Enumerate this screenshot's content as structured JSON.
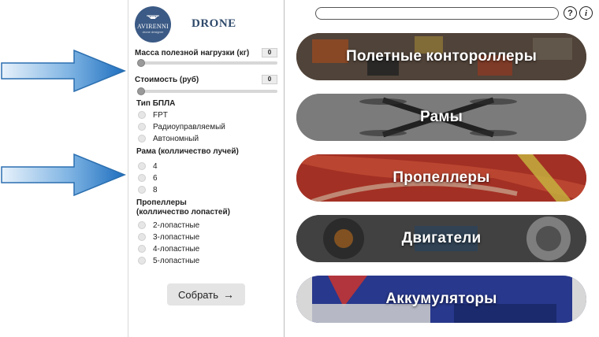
{
  "brand": {
    "logo_text": "AVIRENNI",
    "logo_subtext": "drone designer",
    "title": "DRONE"
  },
  "filters": {
    "payload": {
      "label": "Масса полезной нагрузки (кг)",
      "value": "0"
    },
    "cost": {
      "label": "Стоимость (руб)",
      "value": "0"
    },
    "uav_type": {
      "title": "Тип БПЛА",
      "options": [
        "FPT",
        "Радиоуправляемый",
        "Автономный"
      ]
    },
    "frame": {
      "title": "Рама (колличество лучей)",
      "options": [
        "4",
        "6",
        "8"
      ]
    },
    "propellers": {
      "title_line1": "Пропеллеры",
      "title_line2": "(колличество лопастей)",
      "options": [
        "2-лопастные",
        "3-лопастные",
        "4-лопастные",
        "5-лопастные"
      ]
    }
  },
  "build_button": {
    "label": "Собрать",
    "icon": "arrow-right-icon"
  },
  "search": {
    "value": "",
    "placeholder": ""
  },
  "icons": {
    "help": "?",
    "info": "i"
  },
  "categories": [
    {
      "label": "Полетные контороллеры"
    },
    {
      "label": "Рамы"
    },
    {
      "label": "Пропеллеры"
    },
    {
      "label": "Двигатели"
    },
    {
      "label": "Аккумуляторы"
    }
  ],
  "colors": {
    "arrow_blue": "#2f7fc8",
    "brand_blue": "#2f4a6b",
    "panel_border": "#bdbdbd"
  }
}
